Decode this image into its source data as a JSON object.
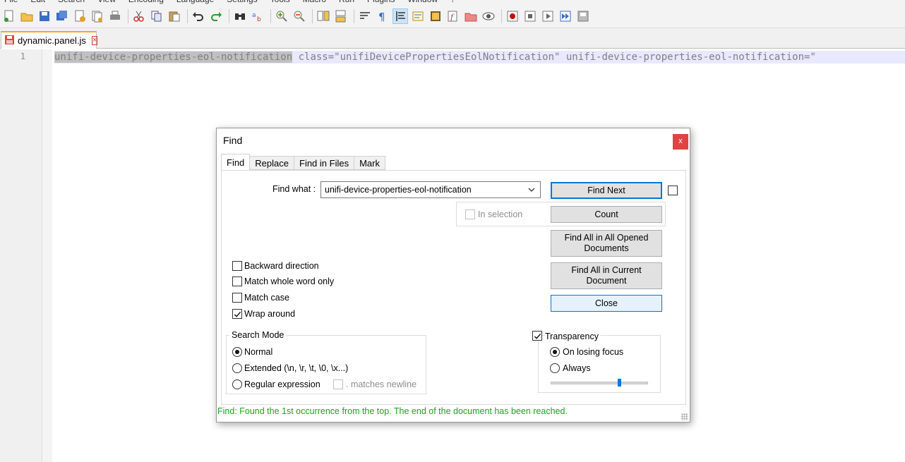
{
  "menu": [
    "File",
    "Edit",
    "Search",
    "View",
    "Encoding",
    "Language",
    "Settings",
    "Tools",
    "Macro",
    "Run",
    "Plugins",
    "Window",
    "?"
  ],
  "tab": {
    "filename": "dynamic.panel.js",
    "close_glyph": "×"
  },
  "editor": {
    "line_number": "1",
    "highlight_text": "unifi-device-properties-eol-notification",
    "rest_text": " class=\"unifiDevicePropertiesEolNotification\" unifi-device-properties-eol-notification=\"",
    "colors": {
      "line_bg": "#e8e8ff",
      "selection_bg": "#c0c0c0"
    }
  },
  "dialog": {
    "title": "Find",
    "close_glyph": "x",
    "tabs": [
      "Find",
      "Replace",
      "Find in Files",
      "Mark"
    ],
    "find_what_label": "Find what :",
    "find_what_value": "unifi-device-properties-eol-notification",
    "in_selection_label": "In selection",
    "buttons": {
      "find_next": "Find Next",
      "count": "Count",
      "find_all_opened": "Find All in All Opened Documents",
      "find_all_current": "Find All in Current Document",
      "close": "Close"
    },
    "options": {
      "backward": {
        "label": "Backward direction",
        "checked": false
      },
      "whole_word": {
        "label": "Match whole word only",
        "checked": false
      },
      "match_case": {
        "label": "Match case",
        "checked": false
      },
      "wrap_around": {
        "label": "Wrap around",
        "checked": true
      }
    },
    "search_mode": {
      "legend": "Search Mode",
      "normal": "Normal",
      "extended": "Extended (\\n, \\r, \\t, \\0, \\x...)",
      "regex": "Regular expression",
      "matches_newline": ". matches newline",
      "selected": "normal"
    },
    "transparency": {
      "label": "Transparency",
      "checked": true,
      "on_losing_focus": "On losing focus",
      "always": "Always",
      "selected": "on_losing_focus",
      "level": 0.7
    },
    "status": "Find: Found the 1st occurrence from the top. The end of the document has been reached.",
    "colors": {
      "status": "#21a021",
      "close_btn": "#e04343",
      "accent": "#0078d7"
    }
  }
}
